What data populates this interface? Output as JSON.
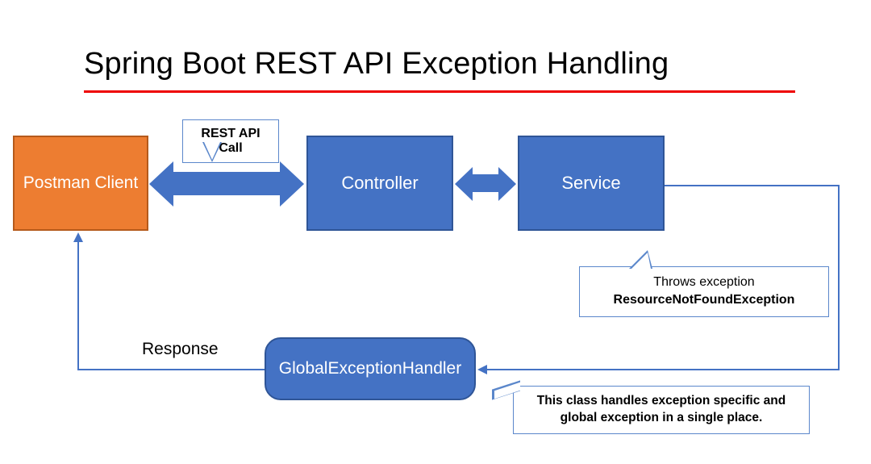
{
  "title": "Spring Boot REST API Exception Handling",
  "nodes": {
    "postman": "Postman Client",
    "controller": "Controller",
    "service": "Service",
    "handler": "GlobalExceptionHandler"
  },
  "callouts": {
    "api_call": "REST API Call",
    "throws_line1": "Throws exception",
    "throws_line2": "ResourceNotFoundException",
    "handles": "This class handles exception specific and global exception in a single place."
  },
  "labels": {
    "response": "Response"
  },
  "colors": {
    "blue": "#4472c4",
    "orange": "#ed7d31",
    "red_line": "#ee0000"
  }
}
